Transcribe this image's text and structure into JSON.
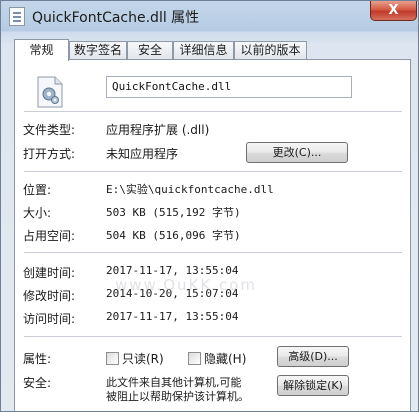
{
  "window": {
    "title": "QuickFontCache.dll 属性",
    "close_glyph": "X"
  },
  "tabs": [
    {
      "label": "常规",
      "active": true
    },
    {
      "label": "数字签名",
      "active": false
    },
    {
      "label": "安全",
      "active": false
    },
    {
      "label": "详细信息",
      "active": false
    },
    {
      "label": "以前的版本",
      "active": false
    }
  ],
  "general": {
    "file_name": "QuickFontCache.dll",
    "file_type": {
      "label": "文件类型:",
      "value": "应用程序扩展 (.dll)"
    },
    "opens_with": {
      "label": "打开方式:",
      "value": "未知应用程序",
      "button": "更改(C)..."
    },
    "location": {
      "label": "位置:",
      "value": "E:\\实验\\quickfontcache.dll"
    },
    "size": {
      "label": "大小:",
      "value": "503 KB (515,192 字节)"
    },
    "size_on_disk": {
      "label": "占用空间:",
      "value": "504 KB (516,096 字节)"
    },
    "created": {
      "label": "创建时间:",
      "value": "2017-11-17, 13:55:04"
    },
    "modified": {
      "label": "修改时间:",
      "value": "2014-10-20, 15:07:04"
    },
    "accessed": {
      "label": "访问时间:",
      "value": "2017-11-17, 13:55:04"
    },
    "attributes": {
      "label": "属性:",
      "readonly": "只读(R)",
      "hidden": "隐藏(H)",
      "advanced_button": "高级(D)..."
    },
    "security": {
      "label": "安全:",
      "text_line1": "此文件来自其他计算机,可能",
      "text_line2": "被阻止以帮助保护该计算机。",
      "unblock_button": "解除锁定(K)"
    }
  },
  "watermark": "www.QuKK.com"
}
